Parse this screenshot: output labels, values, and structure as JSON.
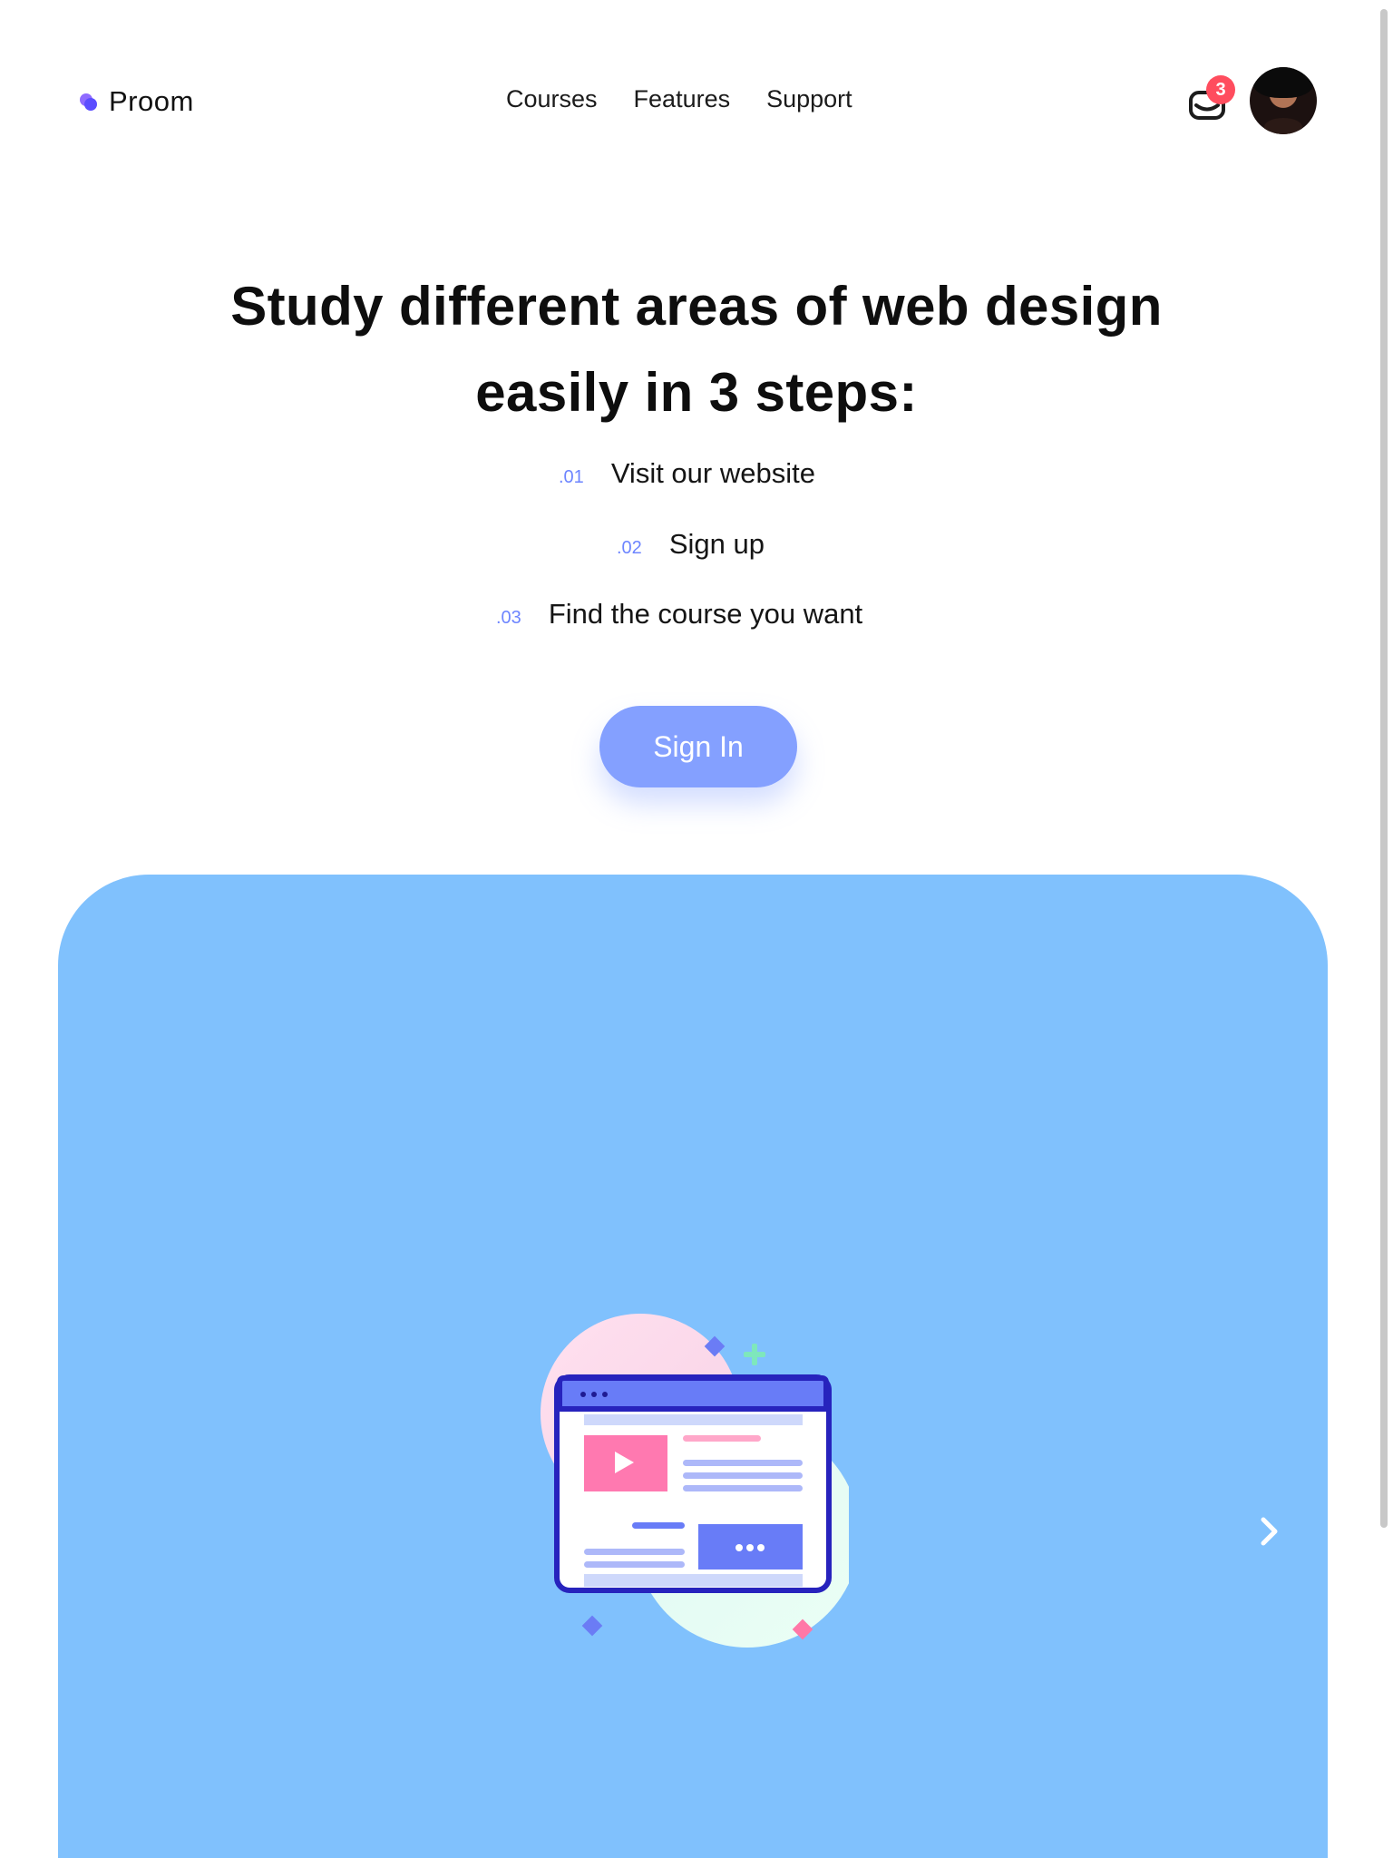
{
  "brand": {
    "name": "Proom"
  },
  "nav": {
    "items": [
      "Courses",
      "Features",
      "Support"
    ]
  },
  "header": {
    "notifications_count": "3"
  },
  "hero": {
    "title_line1": "Study different areas of web design",
    "title_line2": "easily in 3 steps:",
    "steps": [
      {
        "num": ".01",
        "text": "Visit our website"
      },
      {
        "num": ".02",
        "text": "Sign up"
      },
      {
        "num": ".03",
        "text": "Find the course you want"
      }
    ],
    "cta_label": "Sign In"
  },
  "colors": {
    "accent": "#84a0ff",
    "panel": "#80c1fd",
    "badge": "#ff4d5e",
    "step_number": "#6d85ff"
  },
  "icons": [
    "logo-icon",
    "mail-icon",
    "avatar",
    "browser-illustration",
    "chevron-right-icon"
  ]
}
